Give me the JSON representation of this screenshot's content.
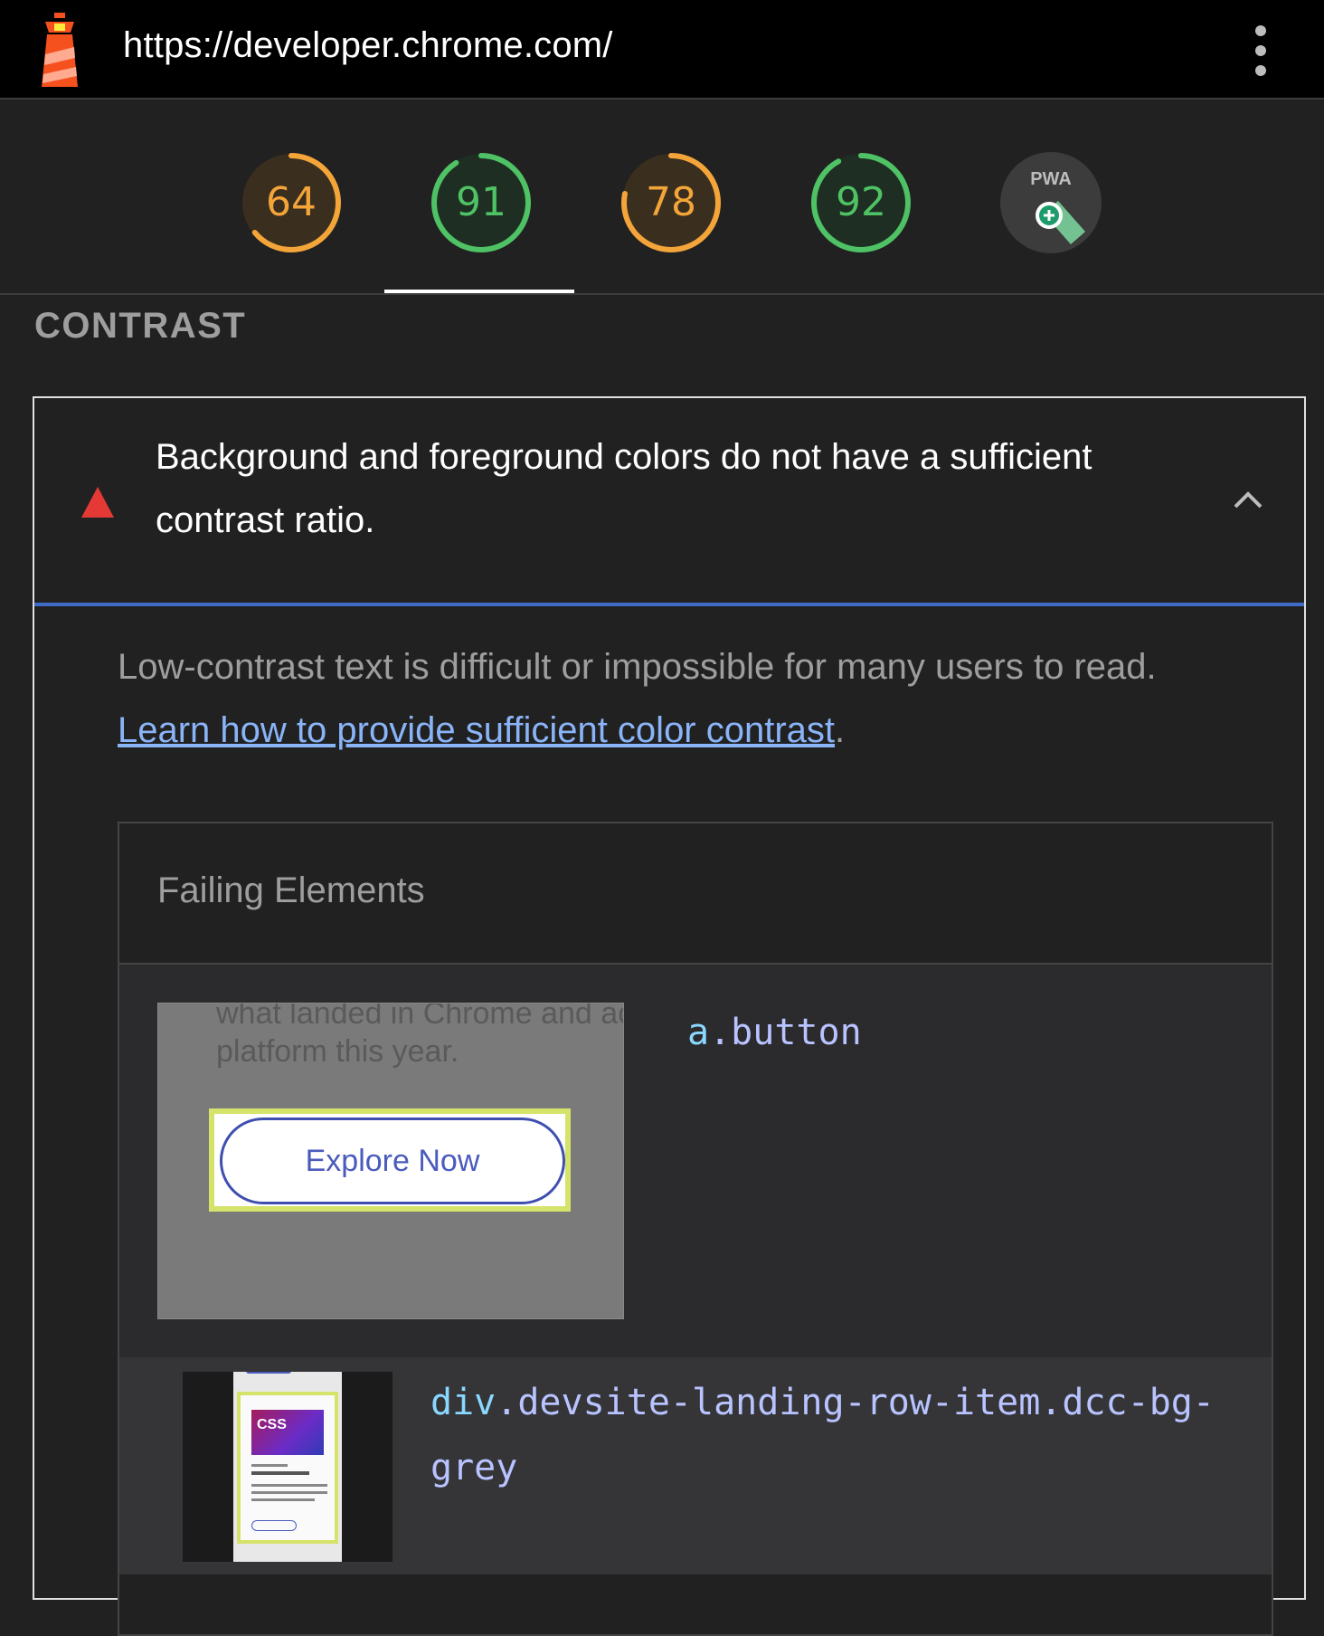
{
  "topbar": {
    "url": "https://developer.chrome.com/",
    "logo_icon": "lighthouse-icon",
    "menu_icon": "kebab-menu-icon"
  },
  "scores": [
    {
      "label": "64",
      "value": 64,
      "color": "#f4a53a",
      "track": "#3a2e1e"
    },
    {
      "label": "91",
      "value": 91,
      "color": "#4fc265",
      "track": "#1e2e22"
    },
    {
      "label": "78",
      "value": 78,
      "color": "#f4a53a",
      "track": "#3a2e1e"
    },
    {
      "label": "92",
      "value": 92,
      "color": "#4fc265",
      "track": "#1e2e22"
    }
  ],
  "pwa": {
    "label": "PWA"
  },
  "section": {
    "title": "CONTRAST"
  },
  "audit": {
    "title": "Background and foreground colors do not have a sufficient contrast ratio.",
    "description": "Low-contrast text is difficult or impossible for many users to read.",
    "link_text": "Learn how to provide sufficient color contrast",
    "link_suffix": ".",
    "status_color": "#e53935"
  },
  "failing_elements": {
    "header": "Failing Elements",
    "items": [
      {
        "selector": "a.button",
        "thumb_line1": "what landed in Chrome and ac",
        "thumb_line2": "platform this year.",
        "thumb_button": "Explore Now"
      },
      {
        "selector": "div.devsite-landing-row-item.dcc-bg-grey",
        "thumb_logo": "CSS"
      }
    ]
  }
}
